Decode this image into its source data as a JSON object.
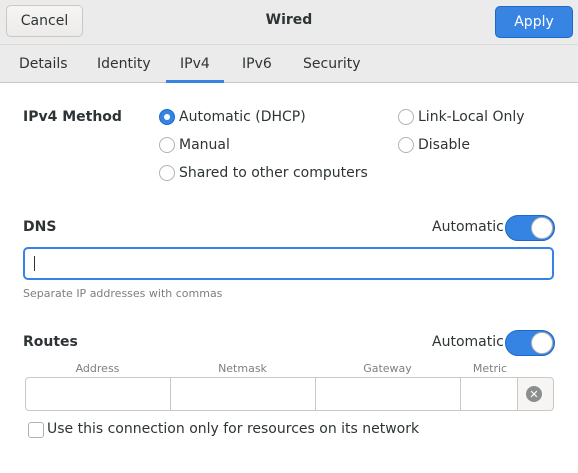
{
  "header": {
    "cancel_label": "Cancel",
    "title": "Wired",
    "apply_label": "Apply"
  },
  "tabs": [
    {
      "label": "Details",
      "active": false
    },
    {
      "label": "Identity",
      "active": false
    },
    {
      "label": "IPv4",
      "active": true
    },
    {
      "label": "IPv6",
      "active": false
    },
    {
      "label": "Security",
      "active": false
    }
  ],
  "ipv4_method": {
    "label": "IPv4 Method",
    "options": [
      {
        "label": "Automatic (DHCP)",
        "checked": true
      },
      {
        "label": "Manual",
        "checked": false
      },
      {
        "label": "Shared to other computers",
        "checked": false
      },
      {
        "label": "Link-Local Only",
        "checked": false
      },
      {
        "label": "Disable",
        "checked": false
      }
    ]
  },
  "dns": {
    "label": "DNS",
    "automatic_label": "Automatic",
    "automatic_on": true,
    "value": "",
    "hint": "Separate IP addresses with commas"
  },
  "routes": {
    "label": "Routes",
    "automatic_label": "Automatic",
    "automatic_on": true,
    "columns": [
      "Address",
      "Netmask",
      "Gateway",
      "Metric"
    ]
  },
  "restrict_checkbox": {
    "label": "Use this connection only for resources on its network",
    "checked": false
  },
  "colors": {
    "accent": "#3584e4",
    "headerbar": "#ebebeb",
    "text": "#2e3436",
    "hint": "#7d8080"
  }
}
